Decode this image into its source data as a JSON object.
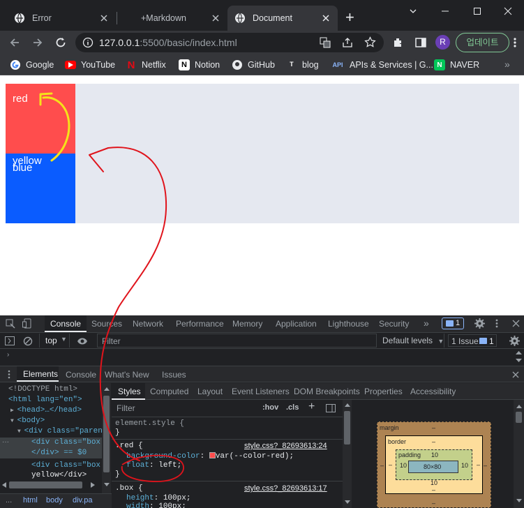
{
  "browser": {
    "tabs": [
      {
        "title": "Error"
      },
      {
        "title": "+Markdown"
      },
      {
        "title": "Document"
      }
    ],
    "new_tab": "+",
    "url": {
      "host": "127.0.0.1",
      "rest": ":5500/basic/index.html"
    },
    "profile_initial": "R",
    "update_label": "업데이트",
    "bookmarks": [
      {
        "label": "Google",
        "icon": "google-icon",
        "color": "#4285f4"
      },
      {
        "label": "YouTube",
        "icon": "youtube-icon",
        "color": "#ff0000"
      },
      {
        "label": "Netflix",
        "icon": "netflix-icon",
        "color": "#e50914"
      },
      {
        "label": "Notion",
        "icon": "notion-icon",
        "color": "#ffffff"
      },
      {
        "label": "GitHub",
        "icon": "github-icon",
        "color": "#ffffff"
      },
      {
        "label": "blog",
        "icon": "blog-icon",
        "color": "#ffffff"
      },
      {
        "label": "APIs & Services | G...",
        "icon": "api-icon",
        "color": "#8ab4f8"
      },
      {
        "label": "NAVER",
        "icon": "naver-icon",
        "color": "#03c75a"
      }
    ]
  },
  "page": {
    "red_box_text": "red",
    "yellow_box_text": "yellow",
    "blue_box_text": "blue",
    "colors": {
      "red": "#ff4d4d",
      "blue": "#0a5cff",
      "parent": "#e5e8f0",
      "annotation_red": "#e0141c",
      "annotation_yellow": "#f5e21a"
    }
  },
  "devtools": {
    "drawer_tabs": [
      "Console",
      "Sources",
      "Network",
      "Performance",
      "Memory",
      "Application",
      "Lighthouse",
      "Security"
    ],
    "issues_badge": "1",
    "console_context": "top",
    "filter_placeholder": "Filter",
    "default_levels": "Default levels",
    "issue_count_label": "1 Issue:",
    "issue_count_badge": "1",
    "main_tabs": [
      "Elements",
      "Console",
      "What's New",
      "Issues"
    ],
    "dom_lines": [
      {
        "indent": 0,
        "text": "<!DOCTYPE html>"
      },
      {
        "indent": 0,
        "text": "<html lang=\"en\">"
      },
      {
        "indent": 1,
        "text": "<head>…</head>"
      },
      {
        "indent": 1,
        "text": "<body>"
      },
      {
        "indent": 2,
        "text": "<div class=\"parent\""
      },
      {
        "indent": 3,
        "text": "<div class=\"box r"
      },
      {
        "indent": 3,
        "text": "</div> == $0"
      },
      {
        "indent": 3,
        "text": "<div class=\"box y"
      },
      {
        "indent": 3,
        "text": "yellow</div>"
      }
    ],
    "breadcrumbs": [
      "...",
      "html",
      "body",
      "div.pa"
    ],
    "styles_tabs": [
      "Styles",
      "Computed",
      "Layout",
      "Event Listeners",
      "DOM Breakpoints",
      "Properties",
      "Accessibility"
    ],
    "styles_filter": "Filter",
    "hov": ":hov",
    "cls": ".cls",
    "rules": {
      "element_style": "element.style {",
      "red_selector": ".red {",
      "red_source": "style.css?_82693613:24",
      "red_bg_prop": "background-color",
      "red_bg_value": "var(--color-red);",
      "red_float_prop": "float",
      "red_float_value": "left;",
      "box_selector": ".box {",
      "box_source": "style.css?_82693613:17",
      "box_height_prop": "height",
      "box_height_value": "100px;",
      "box_width_prop": "width",
      "box_width_value": "100px;"
    },
    "box_model": {
      "margin_label": "margin",
      "margin_value": "–",
      "border_label": "border",
      "border_value": "–",
      "padding_label": "padding",
      "padding_value": "10",
      "content": "80×80",
      "side_value": "10"
    }
  }
}
